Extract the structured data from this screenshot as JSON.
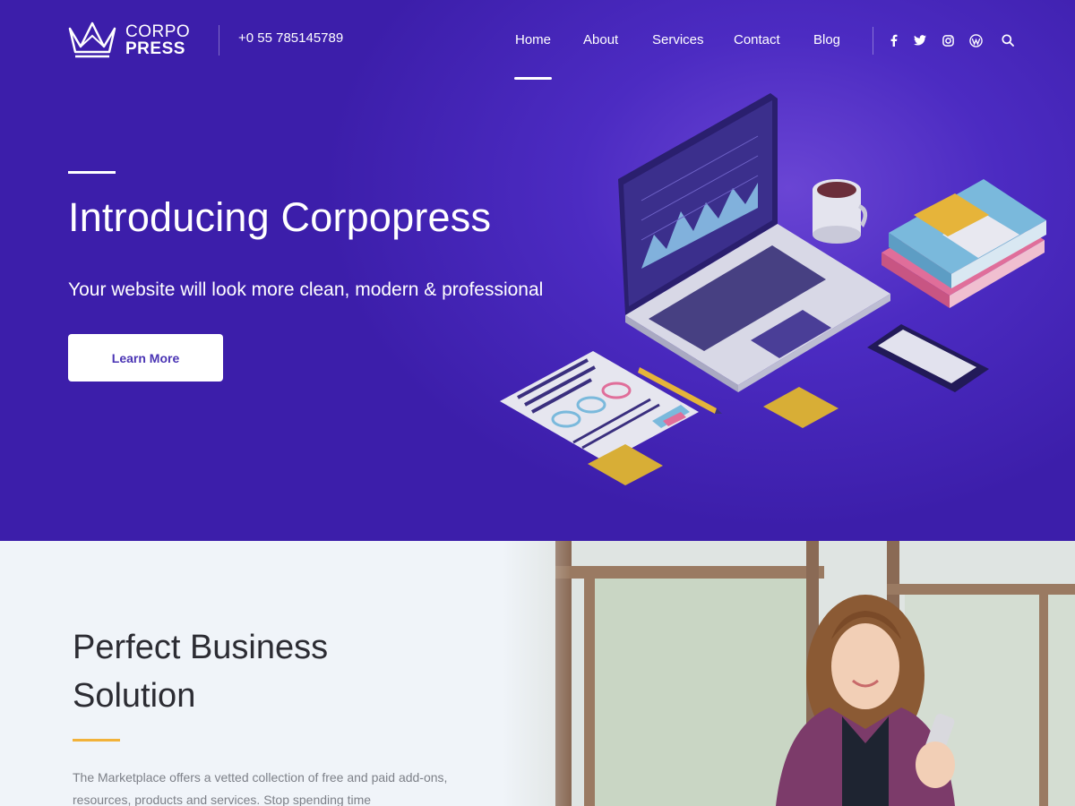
{
  "header": {
    "logo_top": "CORPO",
    "logo_bottom": "PRESS",
    "phone": "+0 55 785145789",
    "nav": [
      {
        "label": "Home",
        "active": true
      },
      {
        "label": "About"
      },
      {
        "label": "Services"
      },
      {
        "label": "Contact"
      },
      {
        "label": "Blog"
      }
    ],
    "social_icons": [
      "facebook-icon",
      "twitter-icon",
      "instagram-icon",
      "wordpress-icon",
      "search-icon"
    ]
  },
  "hero": {
    "title": "Introducing Corpopress",
    "subtitle": "Your website will look more clean, modern & professional",
    "button_label": "Learn More"
  },
  "section": {
    "title": "Perfect Business Solution",
    "text": "The Marketplace offers a vetted collection of free and paid add-ons, resources, products and services. Stop spending time"
  },
  "colors": {
    "hero_bg": "#4c2bc2",
    "accent_yellow": "#f2b23a",
    "button_text": "#4a34b4",
    "section_bg": "#f0f4f9"
  }
}
